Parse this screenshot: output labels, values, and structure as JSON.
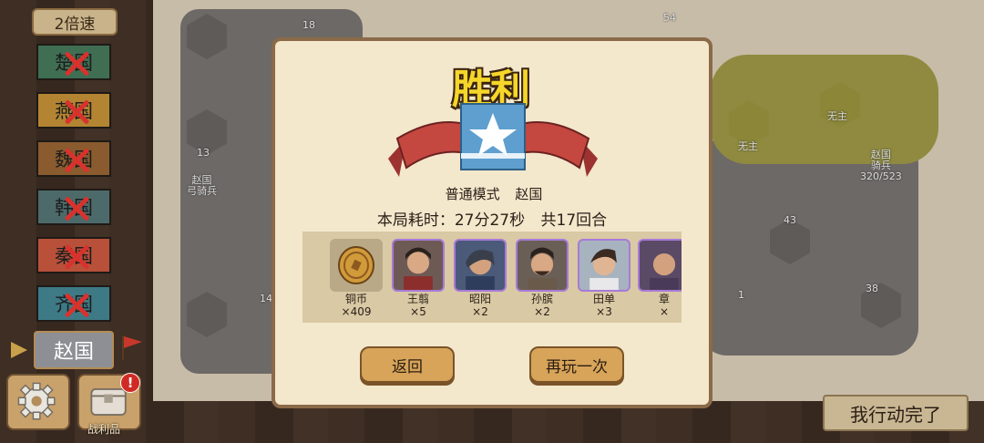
{
  "speed_button": "2倍速",
  "nations": [
    {
      "label": "楚国",
      "color": "#3f6e52",
      "eliminated": true
    },
    {
      "label": "燕国",
      "color": "#b38431",
      "eliminated": true
    },
    {
      "label": "魏国",
      "color": "#8a5b2e",
      "eliminated": true
    },
    {
      "label": "韩国",
      "color": "#4d6a6a",
      "eliminated": true
    },
    {
      "label": "秦国",
      "color": "#b9503a",
      "eliminated": true
    },
    {
      "label": "齐国",
      "color": "#3d7a86",
      "eliminated": true
    }
  ],
  "current_nation": "赵国",
  "spoils_label": "战利品",
  "spoils_badge": "!",
  "end_turn_button": "我行动完了",
  "map_labels": {
    "n1": "18",
    "n2": "54",
    "n3": "13",
    "n4": "43",
    "n5": "14",
    "n6": "38",
    "n7": "1",
    "u_zhao_archer": "赵国\n弓骑兵",
    "u_wuzhu_1": "无主",
    "u_wuzhu_2": "无主",
    "u_zhao_city": "赵国\n骑兵\n320/523"
  },
  "dialog": {
    "title": "胜利",
    "mode": "普通模式",
    "nation": "赵国",
    "time_text": "本局耗时：27分27秒",
    "rounds_text": "共17回合",
    "rewards": [
      {
        "name": "铜币",
        "qty": "×409",
        "type": "coin-icon"
      },
      {
        "name": "王翦",
        "qty": "×5",
        "type": "hero-portrait"
      },
      {
        "name": "昭阳",
        "qty": "×2",
        "type": "hero-portrait"
      },
      {
        "name": "孙膑",
        "qty": "×2",
        "type": "hero-portrait"
      },
      {
        "name": "田单",
        "qty": "×3",
        "type": "hero-portrait"
      },
      {
        "name": "章",
        "qty": "×",
        "type": "hero-portrait"
      }
    ],
    "back_button": "返回",
    "replay_button": "再玩一次"
  }
}
